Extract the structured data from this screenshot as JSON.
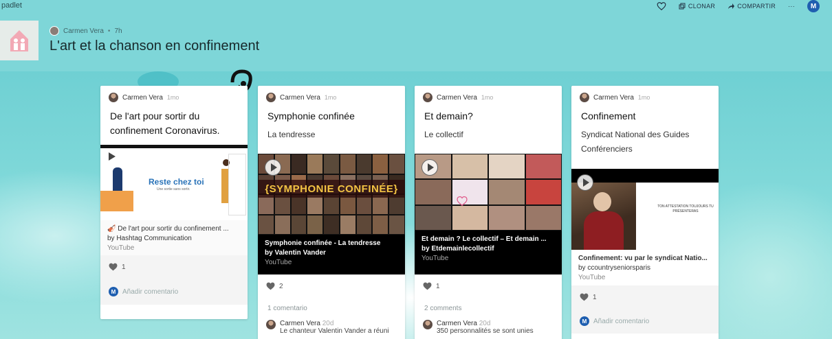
{
  "topbar": {
    "brand": "padlet",
    "clone_label": "CLONAR",
    "share_label": "COMPARTIR",
    "more_label": "···",
    "avatar_letter": "M"
  },
  "header": {
    "author": "Carmen Vera",
    "separator": "•",
    "time": "7h",
    "title": "L'art et la chanson en confinement"
  },
  "colors": {
    "background": "#7ed6d8",
    "accent": "#1f5fb0",
    "card": "#ffffff"
  },
  "cards": [
    {
      "author": "Carmen Vera",
      "time": "1mo",
      "title": "De l'art pour sortir du confinement Coronavirus.",
      "subtitle": "",
      "media": {
        "caption_title": "🎻 De l'art pour sortir du confinement ...",
        "caption_by": "by Hashtag Communication",
        "caption_source": "YouTube",
        "thumb_text": "Reste chez toi",
        "thumb_subtext": "Une sortie sans sortir."
      },
      "likes": "1",
      "comment_prompt": "Añadir comentario",
      "avatar_letter": "M"
    },
    {
      "author": "Carmen Vera",
      "time": "1mo",
      "title": "Symphonie confinée",
      "subtitle": "La tendresse",
      "media": {
        "thumb_text": "{SYMPHONIE CONFINÉE}",
        "caption_title": "Symphonie confinée - La tendresse",
        "caption_by": "by Valentin Vander",
        "caption_source": "YouTube"
      },
      "likes": "2",
      "comments_count": "1 comentario",
      "comment": {
        "name": "Carmen Vera",
        "time": "20d",
        "text": "Le chanteur Valentin Vander a réuni"
      }
    },
    {
      "author": "Carmen Vera",
      "time": "1mo",
      "title": "Et demain?",
      "subtitle": "Le collectif",
      "media": {
        "caption_title": "Et demain ? Le collectif – Et demain ...",
        "caption_by": "by Etdemainlecollectif",
        "caption_source": "YouTube"
      },
      "likes": "1",
      "comments_count": "2 comments",
      "comment": {
        "name": "Carmen Vera",
        "time": "20d",
        "text": "350 personnalités se sont unies"
      }
    },
    {
      "author": "Carmen Vera",
      "time": "1mo",
      "title": "Confinement",
      "subtitle": "Syndicat National des Guides Conférenciers",
      "media": {
        "thumb_text": "TON ATTESTATION TOUJOURS TU PRÉSENTERAS",
        "caption_title": "Confinement: vu par le syndicat Natio...",
        "caption_by": "by ccountryseniorsparis",
        "caption_source": "YouTube"
      },
      "likes": "1",
      "comment_prompt": "Añadir comentario",
      "avatar_letter": "M"
    }
  ]
}
